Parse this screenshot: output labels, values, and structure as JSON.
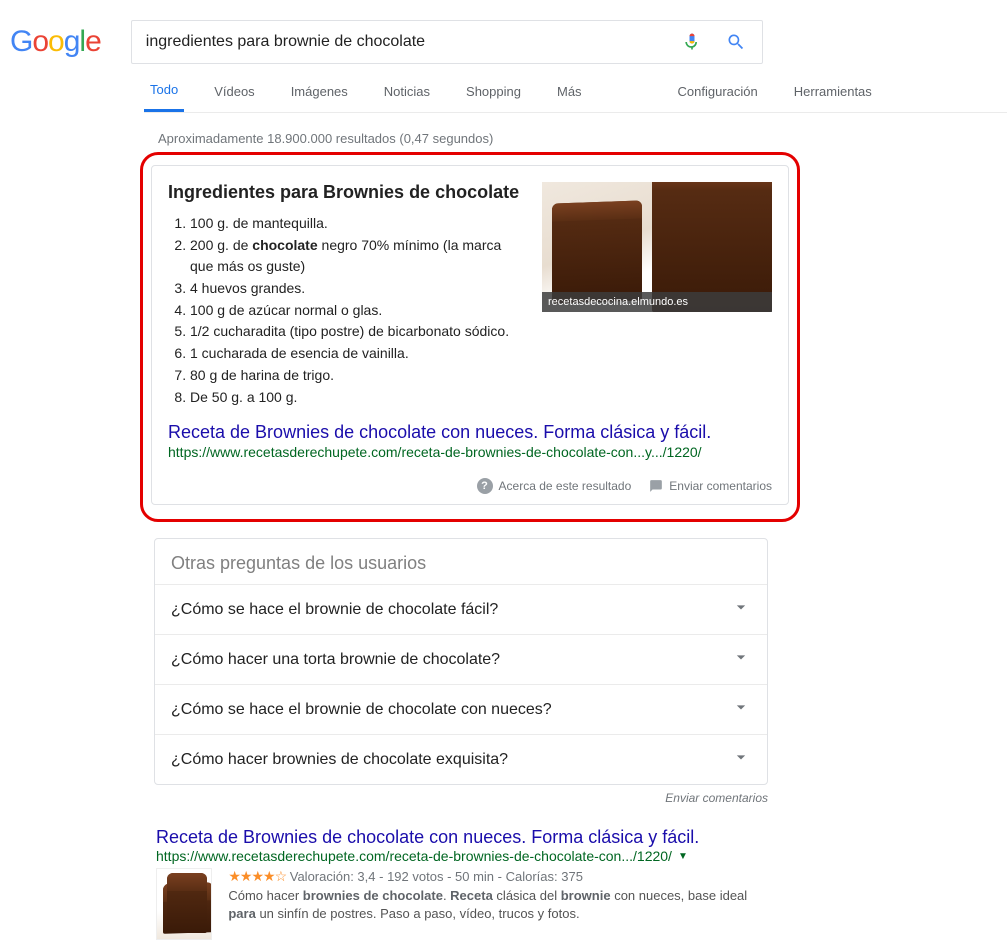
{
  "logo_text": "Google",
  "search": {
    "value": "ingredientes para brownie de chocolate"
  },
  "tabs": {
    "items": [
      "Todo",
      "Vídeos",
      "Imágenes",
      "Noticias",
      "Shopping",
      "Más"
    ],
    "right": [
      "Configuración",
      "Herramientas"
    ],
    "active": 0
  },
  "stats": "Aproximadamente 18.900.000 resultados (0,47 segundos)",
  "featured": {
    "title": "Ingredientes para Brownies de chocolate",
    "list": [
      {
        "pre": "100 g. de mantequilla.",
        "bold": "",
        "post": ""
      },
      {
        "pre": "200 g. de ",
        "bold": "chocolate",
        "post": " negro 70% mínimo (la marca que más os guste)"
      },
      {
        "pre": "4 huevos grandes.",
        "bold": "",
        "post": ""
      },
      {
        "pre": "100 g de azúcar normal o glas.",
        "bold": "",
        "post": ""
      },
      {
        "pre": "1/2 cucharadita (tipo postre) de bicarbonato sódico.",
        "bold": "",
        "post": ""
      },
      {
        "pre": "1 cucharada de esencia de vainilla.",
        "bold": "",
        "post": ""
      },
      {
        "pre": "80 g de harina de trigo.",
        "bold": "",
        "post": ""
      },
      {
        "pre": "De 50 g. a 100 g.",
        "bold": "",
        "post": ""
      }
    ],
    "image_source": "recetasdecocina.elmundo.es",
    "link_text": "Receta de Brownies de chocolate con nueces. Forma clásica y fácil.",
    "link_url": "https://www.recetasderechupete.com/receta-de-brownies-de-chocolate-con...y.../1220/",
    "about": "Acerca de este resultado",
    "feedback": "Enviar comentarios"
  },
  "paa": {
    "title": "Otras preguntas de los usuarios",
    "items": [
      "¿Cómo se hace el brownie de chocolate fácil?",
      "¿Cómo hacer una torta brownie de chocolate?",
      "¿Cómo se hace el brownie de chocolate con nueces?",
      "¿Cómo hacer brownies de chocolate exquisita?"
    ],
    "send_feedback": "Enviar comentarios"
  },
  "result": {
    "title": "Receta de Brownies de chocolate con nueces. Forma clásica y fácil.",
    "url": "https://www.recetasderechupete.com/receta-de-brownies-de-chocolate-con.../1220/",
    "meta": {
      "stars": "★★★★☆",
      "rating_label": "Valoración: 3,4",
      "votes": "192 votos",
      "time": "50 min",
      "cal": "Calorías: 375"
    },
    "snippet_parts": [
      {
        "t": "Cómo hacer ",
        "b": false
      },
      {
        "t": "brownies de chocolate",
        "b": true
      },
      {
        "t": ". ",
        "b": false
      },
      {
        "t": "Receta",
        "b": true
      },
      {
        "t": " clásica del ",
        "b": false
      },
      {
        "t": "brownie",
        "b": true
      },
      {
        "t": " con nueces, base ideal ",
        "b": false
      },
      {
        "t": "para",
        "b": true
      },
      {
        "t": " un sinfín de postres. Paso a paso, vídeo, trucos y fotos.",
        "b": false
      }
    ]
  }
}
